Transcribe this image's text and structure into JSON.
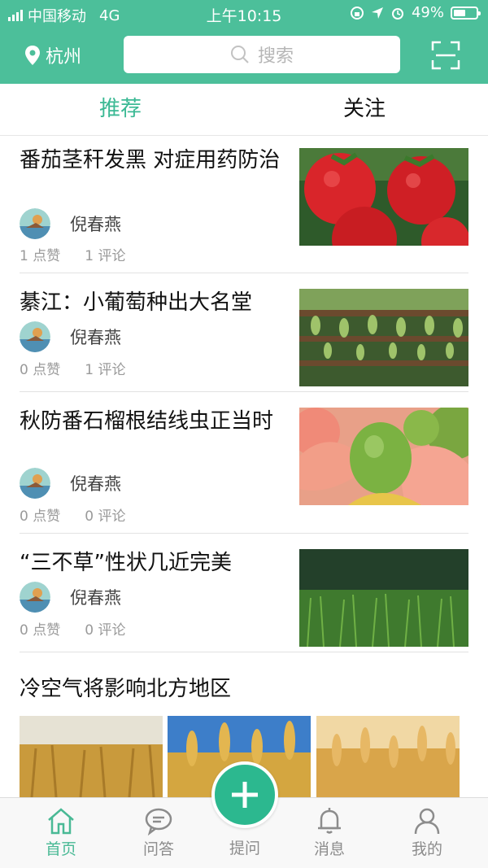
{
  "status_bar": {
    "carrier": "中国移动",
    "network": "4G",
    "time": "上午10:15",
    "battery": "49%"
  },
  "header": {
    "city": "杭州",
    "search_placeholder": "搜索"
  },
  "tabs": [
    {
      "label": "推荐",
      "active": true
    },
    {
      "label": "关注",
      "active": false
    }
  ],
  "feed": [
    {
      "title": "番茄茎秆发黑 对症用药防治",
      "author": "倪春燕",
      "likes": "1 点赞",
      "comments": "1 评论",
      "image": "tomatoes"
    },
    {
      "title": "綦江：小葡萄种出大名堂",
      "author": "倪春燕",
      "likes": "0 点赞",
      "comments": "1 评论",
      "image": "grapes"
    },
    {
      "title": "秋防番石榴根结线虫正当时",
      "author": "倪春燕",
      "likes": "0 点赞",
      "comments": "0 评论",
      "image": "guava"
    },
    {
      "title": "“三不草”性状几近完美",
      "author": "倪春燕",
      "likes": "0 点赞",
      "comments": "0 评论",
      "image": "grass"
    },
    {
      "title": "冷空气将影响北方地区",
      "images": [
        "wheat-1",
        "wheat-2",
        "wheat-3"
      ]
    }
  ],
  "tabbar": {
    "home": "首页",
    "qa": "问答",
    "ask": "提问",
    "messages": "消息",
    "mine": "我的"
  },
  "colors": {
    "brand": "#4cbf9a",
    "active_tab": "#3bb994",
    "fab": "#2cb88f"
  }
}
